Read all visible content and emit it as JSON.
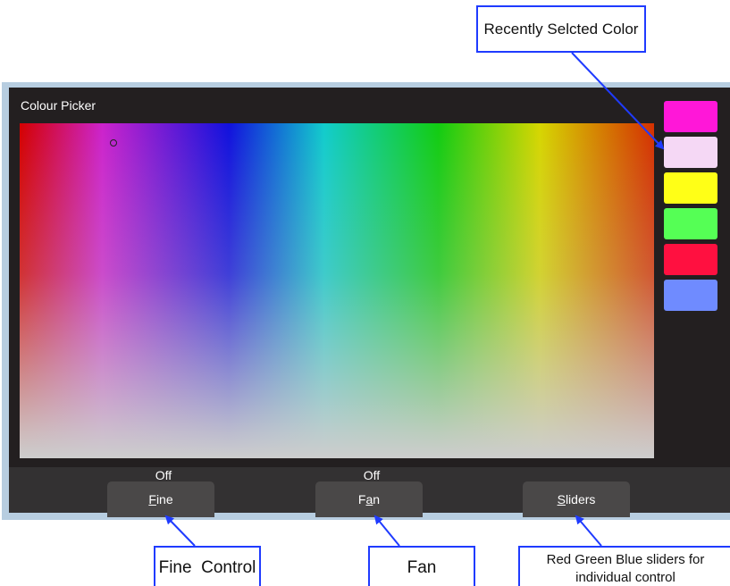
{
  "window": {
    "title": "Colour Picker"
  },
  "recent_swatches": [
    {
      "name": "magenta",
      "color": "#ff17d8"
    },
    {
      "name": "light-pink",
      "color": "#f5d8f5"
    },
    {
      "name": "yellow",
      "color": "#ffff17"
    },
    {
      "name": "green",
      "color": "#55ff55"
    },
    {
      "name": "crimson",
      "color": "#ff1040"
    },
    {
      "name": "blue",
      "color": "#6f8bff"
    }
  ],
  "toolbar": {
    "fine": {
      "status": "Off",
      "label_prefix": "",
      "label_accel": "F",
      "label_rest": "ine"
    },
    "fan": {
      "status": "Off",
      "label_prefix": "F",
      "label_accel": "a",
      "label_rest": "n"
    },
    "sliders": {
      "label_prefix": "",
      "label_accel": "S",
      "label_rest": "liders"
    }
  },
  "callouts": {
    "recent": "Recently Selcted Color",
    "fine": "Fine  Control",
    "fan": "Fan",
    "sliders": "Red Green Blue sliders for individual control"
  }
}
